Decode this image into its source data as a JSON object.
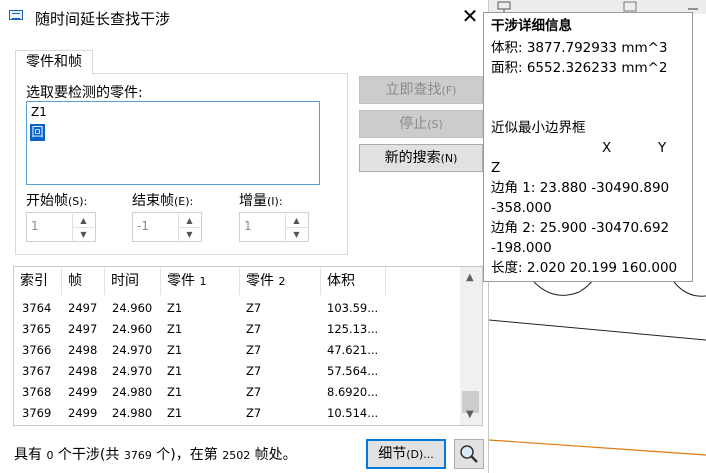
{
  "dialog": {
    "title": "随时间延长查找干涉",
    "close_label": "✕",
    "tab_label": "零件和帧",
    "select_label": "选取要检测的零件:",
    "parts": [
      "Z1",
      "回"
    ],
    "fields": {
      "start_label": "开始帧",
      "start_key": "(S):",
      "start_value": "1",
      "end_label": "结束帧",
      "end_key": "(E):",
      "end_value": "-1",
      "inc_label": "增量",
      "inc_key": "(I):",
      "inc_value": "1"
    },
    "buttons": {
      "find_now": "立即查找",
      "find_now_key": "(F)",
      "stop": "停止",
      "stop_key": "(S)",
      "new_search": "新的搜索",
      "new_search_key": "(N)",
      "details": "细节",
      "details_key": "(D)..."
    },
    "table": {
      "columns": [
        {
          "label": "索引",
          "sub": ""
        },
        {
          "label": "帧",
          "sub": ""
        },
        {
          "label": "时间",
          "sub": ""
        },
        {
          "label": "零件 ",
          "sub": "1"
        },
        {
          "label": "零件 ",
          "sub": "2"
        },
        {
          "label": "体积",
          "sub": ""
        }
      ],
      "rows": [
        [
          "3764",
          "2497",
          "24.960",
          "Z1",
          "Z7",
          "103.59..."
        ],
        [
          "3765",
          "2497",
          "24.960",
          "Z1",
          "Z7",
          "125.13..."
        ],
        [
          "3766",
          "2498",
          "24.970",
          "Z1",
          "Z7",
          "47.621..."
        ],
        [
          "3767",
          "2498",
          "24.970",
          "Z1",
          "Z7",
          "57.564..."
        ],
        [
          "3768",
          "2499",
          "24.980",
          "Z1",
          "Z7",
          "8.6920..."
        ],
        [
          "3769",
          "2499",
          "24.980",
          "Z1",
          "Z7",
          "10.514..."
        ]
      ]
    },
    "status": {
      "p1": "具有 ",
      "count": "0",
      "p2": " 个干涉(共 ",
      "total": "3769",
      "p3": " 个)，在第 ",
      "frame": "2502",
      "p4": " 帧处。"
    }
  },
  "tooltip": {
    "title": "干涉详细信息",
    "volume": "体积: 3877.792933 mm^3",
    "area": "面积: 6552.326233 mm^2",
    "bbox_title": "近似最小边界框",
    "col_x": "X",
    "col_y": "Y",
    "col_z": "Z",
    "corner1_a": "边角 1: 23.880 -30490.890",
    "corner1_b": "-358.000",
    "corner2_a": "边角 2: 25.900 -30470.692",
    "corner2_b": "-198.000",
    "length": "长度: 2.020 20.199 160.000"
  },
  "colors": {
    "accent": "#0078d7",
    "selection": "#0a63c8",
    "cad_line_orange": "#e07a10"
  }
}
